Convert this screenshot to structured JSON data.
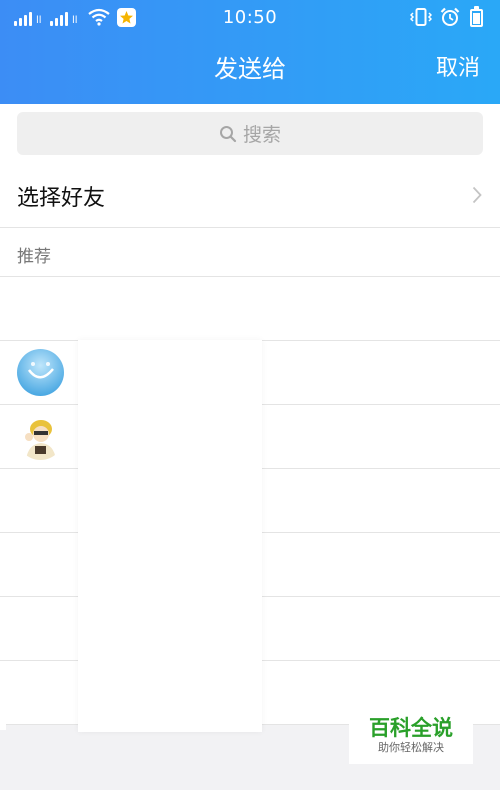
{
  "status_bar": {
    "time": "10:50",
    "sim1_label": "ll",
    "sim2_label": "ll"
  },
  "header": {
    "title": "发送给",
    "cancel_label": "取消"
  },
  "search": {
    "placeholder": "搜索"
  },
  "select_friends": {
    "label": "选择好友"
  },
  "recommended": {
    "label": "推荐"
  },
  "watermark": {
    "title": "百科全说",
    "subtitle": "助你轻松解决"
  },
  "colors": {
    "header_start": "#3c8df5",
    "header_end": "#2aa8f7",
    "watermark_green": "#2aa02a"
  }
}
